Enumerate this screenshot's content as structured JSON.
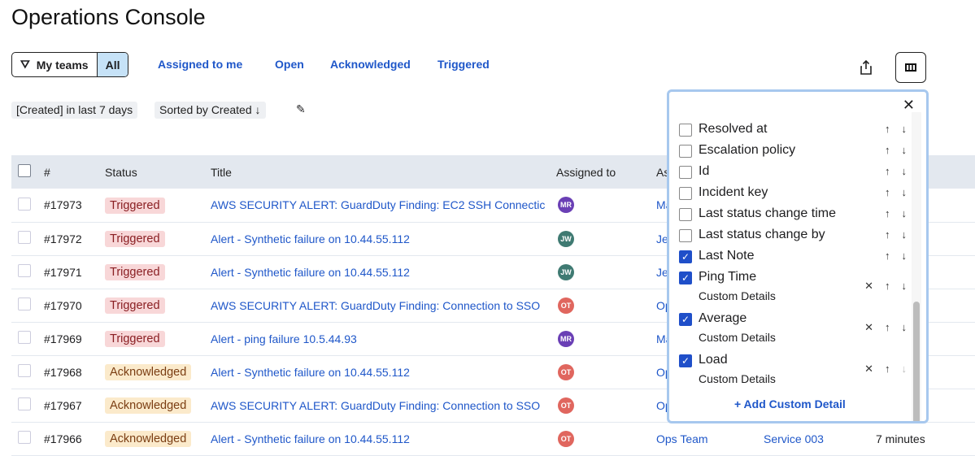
{
  "title": "Operations Console",
  "filters": {
    "my_teams": "My teams",
    "all": "All",
    "tabs": [
      "Assigned to me",
      "Open",
      "Acknowledged",
      "Triggered"
    ],
    "chip_created": "[Created] in last 7 days",
    "chip_sorted": "Sorted by Created ↓"
  },
  "colors": {
    "accent": "#1f57c9",
    "triggered_bg": "#f8d7d8",
    "acknowledged_bg": "#fbeacb"
  },
  "table": {
    "headers": [
      "#",
      "Status",
      "Title",
      "Assigned to",
      "As"
    ],
    "rows": [
      {
        "id": "#17973",
        "status": "Triggered",
        "title": "AWS SECURITY ALERT: GuardDuty Finding: EC2 SSH Connectic",
        "initials": "MR",
        "avatar": "#6a3fb5",
        "team": "Ma",
        "service": "",
        "created": ""
      },
      {
        "id": "#17972",
        "status": "Triggered",
        "title": "Alert - Synthetic failure on 10.44.55.112",
        "initials": "JW",
        "avatar": "#3f7a72",
        "team": "Je",
        "service": "",
        "created": ""
      },
      {
        "id": "#17971",
        "status": "Triggered",
        "title": "Alert - Synthetic failure on 10.44.55.112",
        "initials": "JW",
        "avatar": "#3f7a72",
        "team": "Je",
        "service": "",
        "created": ""
      },
      {
        "id": "#17970",
        "status": "Triggered",
        "title": "AWS SECURITY ALERT: GuardDuty Finding: Connection to SSO",
        "initials": "OT",
        "avatar": "#e0665e",
        "team": "Op",
        "service": "",
        "created": ""
      },
      {
        "id": "#17969",
        "status": "Triggered",
        "title": "Alert - ping failure 10.5.44.93",
        "initials": "MR",
        "avatar": "#6a3fb5",
        "team": "Ma",
        "service": "",
        "created": ""
      },
      {
        "id": "#17968",
        "status": "Acknowledged",
        "title": "Alert - Synthetic failure on 10.44.55.112",
        "initials": "OT",
        "avatar": "#e0665e",
        "team": "Op",
        "service": "",
        "created": ""
      },
      {
        "id": "#17967",
        "status": "Acknowledged",
        "title": "AWS SECURITY ALERT: GuardDuty Finding: Connection to SSO",
        "initials": "OT",
        "avatar": "#e0665e",
        "team": "Op",
        "service": "",
        "created": ""
      },
      {
        "id": "#17966",
        "status": "Acknowledged",
        "title": "Alert - Synthetic failure on 10.44.55.112",
        "initials": "OT",
        "avatar": "#e0665e",
        "team": "Ops Team",
        "service": "Service 003",
        "created": "7 minutes"
      }
    ]
  },
  "columns_popover": {
    "items": [
      {
        "label": "Resolved at",
        "checked": false
      },
      {
        "label": "Escalation policy",
        "checked": false
      },
      {
        "label": "Id",
        "checked": false
      },
      {
        "label": "Incident key",
        "checked": false
      },
      {
        "label": "Last status change time",
        "checked": false
      },
      {
        "label": "Last status change by",
        "checked": false
      },
      {
        "label": "Last Note",
        "checked": true
      },
      {
        "label": "Ping Time",
        "checked": true,
        "sub": "Custom Details"
      },
      {
        "label": "Average",
        "checked": true,
        "sub": "Custom Details"
      },
      {
        "label": "Load",
        "checked": true,
        "sub": "Custom Details"
      }
    ],
    "add_label": "+ Add Custom Detail"
  }
}
